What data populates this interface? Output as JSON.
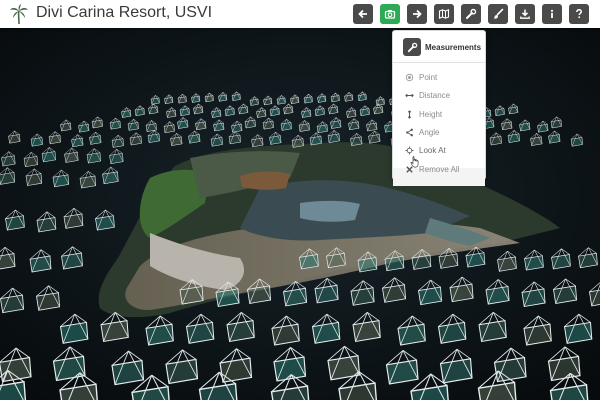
{
  "app": {
    "title": "Divi Carina Resort, USVI"
  },
  "toolbar": {
    "buttons": [
      {
        "name": "back-button",
        "icon": "arrow-left-icon",
        "active": false
      },
      {
        "name": "camera-button",
        "icon": "camera-icon",
        "active": true
      },
      {
        "name": "forward-button",
        "icon": "arrow-right-icon",
        "active": false
      },
      {
        "name": "map-button",
        "icon": "map-icon",
        "active": false
      },
      {
        "name": "measure-button",
        "icon": "wrench-icon",
        "active": false
      },
      {
        "name": "brush-button",
        "icon": "paintbrush-icon",
        "active": false
      },
      {
        "name": "download-button",
        "icon": "download-icon",
        "active": false
      },
      {
        "name": "info-button",
        "icon": "info-icon",
        "active": false
      },
      {
        "name": "help-button",
        "icon": "question-icon",
        "active": false
      }
    ]
  },
  "measurements": {
    "title": "Measurements",
    "items": [
      {
        "label": "Point",
        "icon": "point-icon"
      },
      {
        "label": "Distance",
        "icon": "distance-icon"
      },
      {
        "label": "Height",
        "icon": "height-icon"
      },
      {
        "label": "Angle",
        "icon": "angle-icon"
      },
      {
        "label": "Look At",
        "icon": "crosshair-icon"
      },
      {
        "label": "Remove All",
        "icon": "close-icon"
      }
    ]
  },
  "colors": {
    "toolbar_button": "#4a4a4a",
    "toolbar_active": "#2eaa55",
    "scene_background": "#0c1316"
  }
}
